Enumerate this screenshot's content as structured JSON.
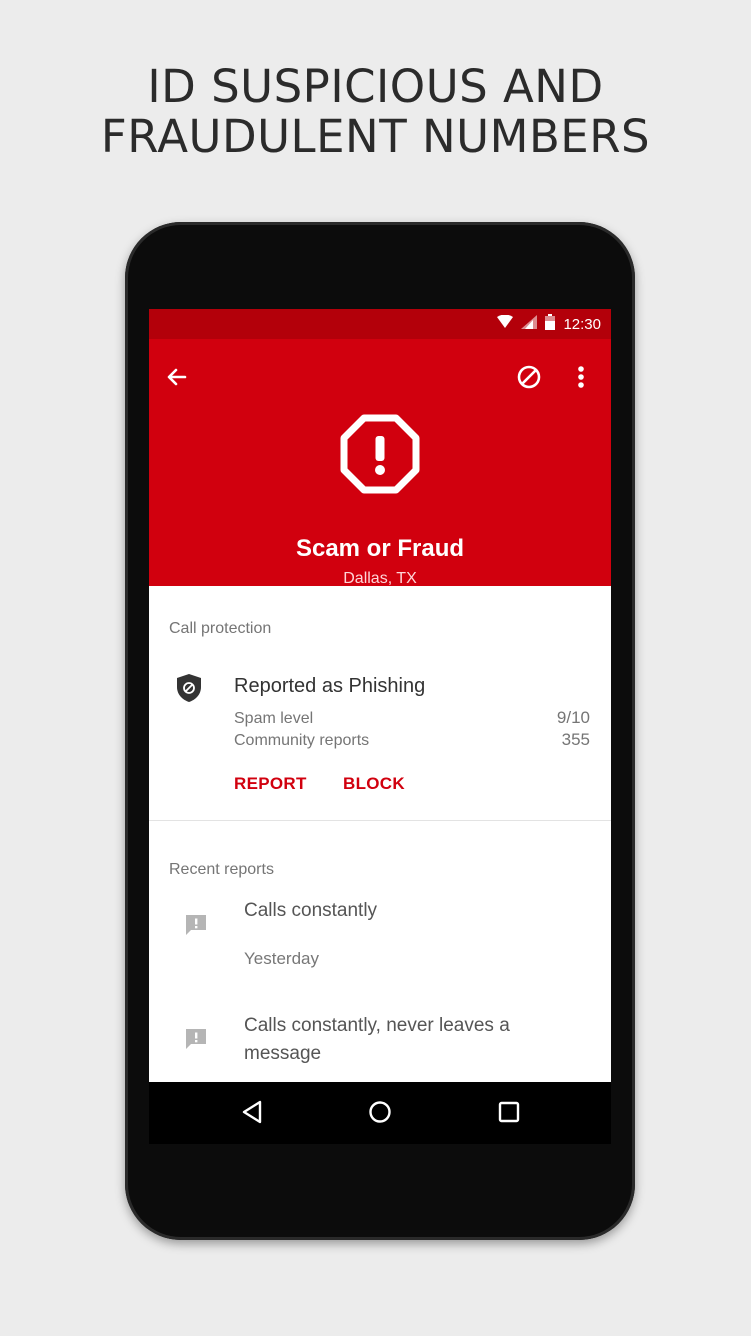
{
  "headline": {
    "line1": "ID SUSPICIOUS AND",
    "line2": "FRAUDULENT NUMBERS"
  },
  "status_bar": {
    "time": "12:30",
    "icons": [
      "wifi-icon",
      "signal-icon",
      "battery-icon"
    ]
  },
  "app_bar": {
    "back_icon": "arrow-left-icon",
    "block_icon": "block-icon",
    "menu_icon": "more-vert-icon",
    "alert_icon": "octagon-alert-icon",
    "title": "Scam or Fraud",
    "subtitle": "Dallas, TX"
  },
  "call_protection": {
    "section_label": "Call protection",
    "status_icon": "shield-block-icon",
    "status_title": "Reported as Phishing",
    "spam_level_label": "Spam level",
    "spam_level_value": "9/10",
    "community_reports_label": "Community reports",
    "community_reports_value": "355",
    "report_button": "REPORT",
    "block_button": "BLOCK"
  },
  "recent_reports": {
    "section_label": "Recent reports",
    "items": [
      {
        "icon": "report-message-icon",
        "text": "Calls constantly",
        "date": "Yesterday"
      },
      {
        "icon": "report-message-icon",
        "text": "Calls constantly, never leaves a message"
      }
    ]
  },
  "nav_bar": {
    "back": "nav-back-icon",
    "home": "nav-home-icon",
    "recents": "nav-recents-icon"
  },
  "colors": {
    "brand_red": "#d1000e",
    "status_red": "#b3000a",
    "background": "#ececec"
  }
}
